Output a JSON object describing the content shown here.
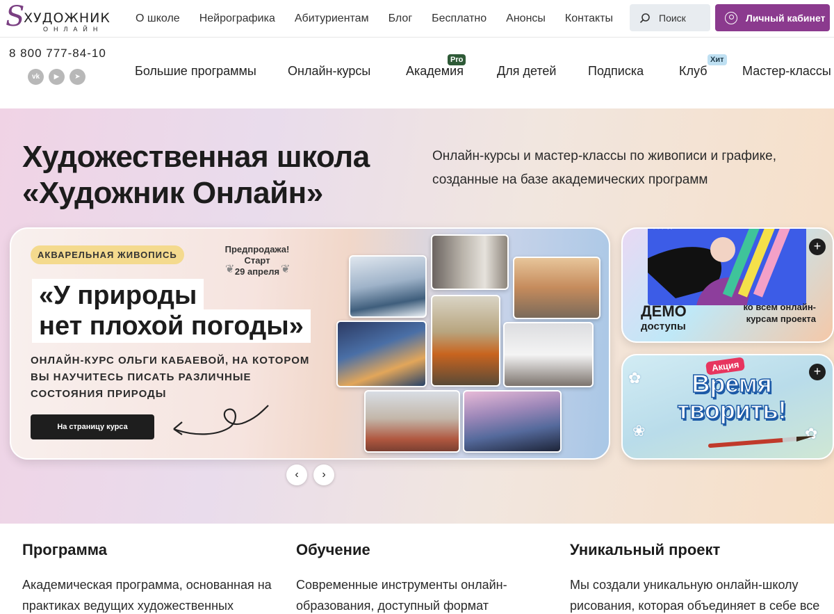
{
  "header": {
    "logo_word": "ХУДОЖНИК",
    "logo_sub": "ОНЛАЙН",
    "top_nav": [
      "О школе",
      "Нейрографика",
      "Абитуриентам",
      "Блог",
      "Бесплатно",
      "Анонсы",
      "Контакты"
    ],
    "search_label": "Поиск",
    "cabinet_label": "Личный кабинет"
  },
  "contacts": {
    "phone": "8 800 777-84-10",
    "socials": [
      "vk-icon",
      "youtube-icon",
      "telegram-icon"
    ]
  },
  "main_nav": [
    "Большие программы",
    "Онлайн-курсы",
    "Академия",
    "Для детей",
    "Подписка",
    "Клуб",
    "Мастер-классы"
  ],
  "badges": {
    "academy": "Pro",
    "club": "Хит"
  },
  "hero": {
    "title_line1": "Художественная школа",
    "title_line2": "«Художник Онлайн»",
    "subtitle": "Онлайн-курсы и мастер-классы по живописи и графике, созданные на базе академических программ"
  },
  "slide": {
    "tag": "АКВАРЕЛЬНАЯ ЖИВОПИСЬ",
    "presale": "Предпродажа!",
    "start": "Старт",
    "date": "29 апреля",
    "title_line1": "«У природы",
    "title_line2": "нет плохой погоды»",
    "description": "ОНЛАЙН-КУРС ОЛЬГИ КАБАЕВОЙ, НА КОТОРОМ ВЫ НАУЧИТЕСЬ ПИСАТЬ РАЗЛИЧНЫЕ СОСТОЯНИЯ ПРИРОДЫ",
    "button": "На страницу курса"
  },
  "demo_card": {
    "left_big": "ДЕМО",
    "left_small": "доступы",
    "right": "ко всем онлайн-курсам проекта"
  },
  "promo_card": {
    "tag": "Акция",
    "title": "Время творить!"
  },
  "features": [
    {
      "title": "Программа",
      "text": "Академическая программа, основанная на практиках ведущих художественных"
    },
    {
      "title": "Обучение",
      "text": "Современные инструменты онлайн-образования, доступный формат обучения"
    },
    {
      "title": "Уникальный проект",
      "text": "Мы создали уникальную онлайн-школу рисования, которая объединяет в себе все"
    }
  ],
  "colors": {
    "brand": "#8b3a8e",
    "dark": "#1e1e1e",
    "tag_yellow": "#f4da8e"
  }
}
